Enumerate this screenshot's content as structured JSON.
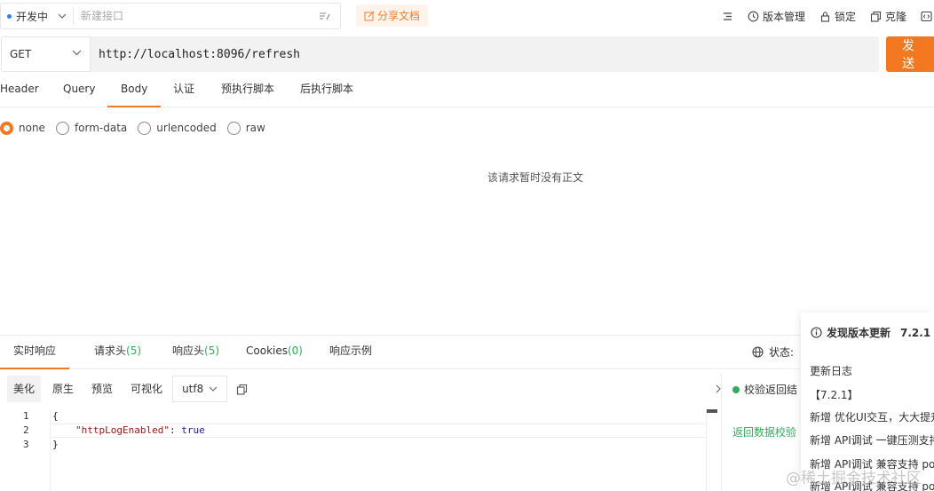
{
  "env": {
    "label": "开发中",
    "api_placeholder": "新建接口"
  },
  "toolbar": {
    "share_label": "分享文档",
    "version_label": "版本管理",
    "lock_label": "锁定",
    "clone_label": "克隆"
  },
  "request": {
    "method": "GET",
    "url": "http://localhost:8096/refresh",
    "send_label": "发 送"
  },
  "request_tabs": [
    "Header",
    "Query",
    "Body",
    "认证",
    "预执行脚本",
    "后执行脚本"
  ],
  "active_request_tab": "Body",
  "body_options": [
    "none",
    "form-data",
    "urlencoded",
    "raw"
  ],
  "selected_body_option": "none",
  "empty_body_text": "该请求暂时没有正文",
  "response_tabs": {
    "realtime": "实时响应",
    "req_headers": "请求头",
    "req_headers_count": "(5)",
    "resp_headers": "响应头",
    "resp_headers_count": "(5)",
    "cookies": "Cookies",
    "cookies_count": "(0)",
    "example": "响应示例"
  },
  "status_label": "状态:",
  "format_options": [
    "美化",
    "原生",
    "预览",
    "可视化"
  ],
  "active_format": "美化",
  "encoding": "utf8",
  "code": {
    "line_numbers": [
      "1",
      "2",
      "3"
    ],
    "open": "{",
    "key": "\"httpLogEnabled\"",
    "sep": ": ",
    "value": "true",
    "close": "}"
  },
  "validation": {
    "line1": "校验返回结",
    "line2": "返回数据校验"
  },
  "update_panel": {
    "title": "发现版本更新",
    "version": "7.2.1",
    "lines": [
      "更新日志",
      "【7.2.1】",
      "新增 优化UI交互，大大提升",
      "新增 API调试 一键压测支持",
      "新增 API调试 兼容支持 po",
      "新增 API调试 兼容支持 po"
    ]
  },
  "watermark": "@稀土掘金技术社区",
  "colors": {
    "accent": "#f47820",
    "green": "#2fae5a"
  }
}
